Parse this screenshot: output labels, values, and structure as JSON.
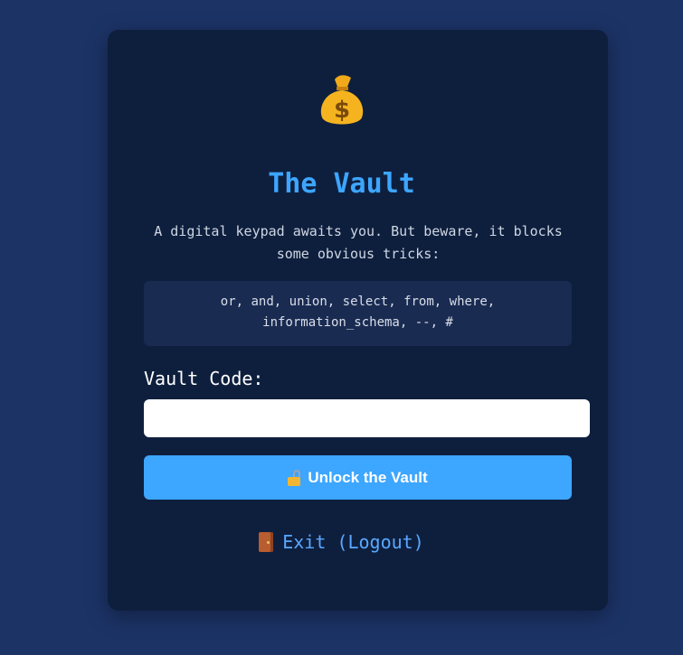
{
  "header": {
    "icon": "money-bag-icon",
    "title": "The Vault"
  },
  "intro": {
    "description": "A digital keypad awaits you. But beware, it blocks some obvious tricks:",
    "blocked_terms": "or, and, union, select, from, where, information_schema, --, #"
  },
  "form": {
    "code_label": "Vault Code:",
    "code_value": "",
    "code_placeholder": "",
    "submit_icon": "unlocked-padlock-icon",
    "submit_label": "Unlock the Vault"
  },
  "footer": {
    "exit_icon": "door-icon",
    "exit_label": "Exit (Logout)"
  },
  "colors": {
    "page_background": "#1c3366",
    "card_background": "#0e1f3e",
    "accent": "#3da6ff",
    "blocked_box": "#1a2b52"
  }
}
